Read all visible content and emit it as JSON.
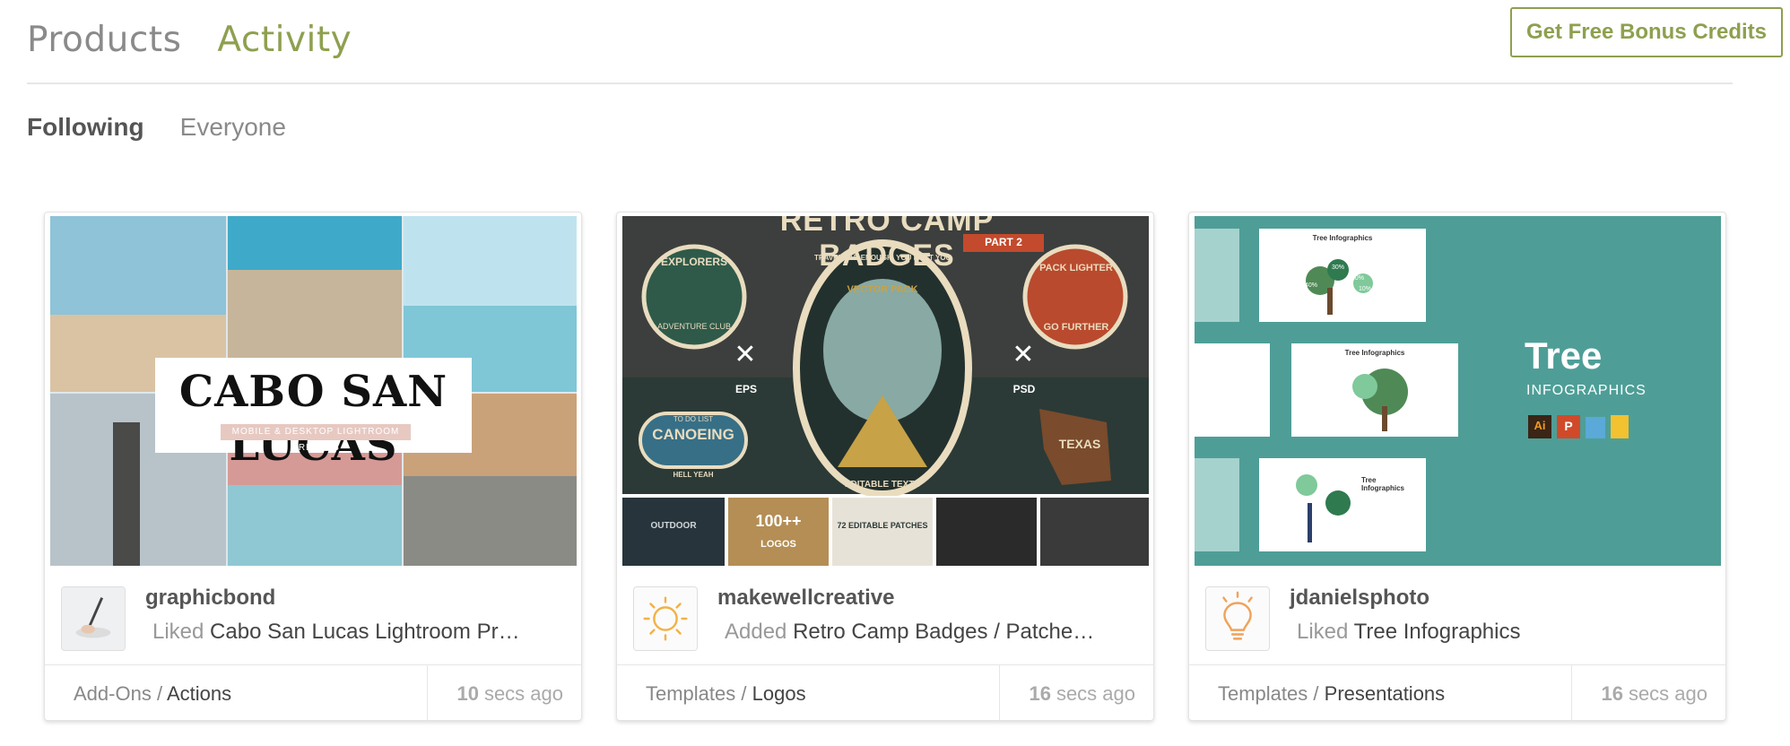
{
  "nav": {
    "tabs": [
      {
        "label": "Products",
        "active": false
      },
      {
        "label": "Activity",
        "active": true
      }
    ],
    "bonus_button": "Get Free Bonus Credits"
  },
  "filters": [
    {
      "label": "Following",
      "active": true
    },
    {
      "label": "Everyone",
      "active": false
    }
  ],
  "colors": {
    "accent": "#8ea04f",
    "teal": "#4e9e97"
  },
  "cards": [
    {
      "thumb_title": "CABO SAN LUCAS",
      "thumb_subtitle": "MOBILE & DESKTOP LIGHTROOM PRESETS",
      "avatar_icon": "user-photo-avatar",
      "user": "graphicbond",
      "verb": "Liked",
      "item": "Cabo San Lucas Lightroom Pr…",
      "category": "Add-Ons",
      "subcategory": "Actions",
      "time_value": "10",
      "time_unit": "secs ago"
    },
    {
      "thumb_title": "RETRO CAMP BADGES",
      "thumb_badges": [
        "EXPLORERS",
        "ADVENTURE CLUB",
        "PART 2",
        "VECTOR PACK",
        "TRAVEL FAR ENOUGH, YOU MEET YOURSELF",
        "PACK LIGHTER",
        "GO FURTHER",
        "EPS",
        "PSD",
        "CANOEING",
        "TO DO LIST",
        "HELL YEAH",
        "TEXAS",
        "EDITABLE TEXTS",
        "OUTDOOR",
        "100++",
        "LOGOS",
        "72 EDITABLE PATCHES"
      ],
      "avatar_icon": "sun-icon",
      "user": "makewellcreative",
      "verb": "Added",
      "item": "Retro Camp Badges / Patche…",
      "category": "Templates",
      "subcategory": "Logos",
      "time_value": "16",
      "time_unit": "secs ago"
    },
    {
      "thumb_title": "Tree",
      "thumb_subtitle": "INFOGRAPHICS",
      "thumb_slide_title": "Tree Infographics",
      "thumb_percents": [
        "30%",
        "40%",
        "20%",
        "10%"
      ],
      "thumb_app_icons": [
        "Ai",
        "P"
      ],
      "avatar_icon": "lightbulb-icon",
      "user": "jdanielsphoto",
      "verb": "Liked",
      "item": "Tree Infographics",
      "category": "Templates",
      "subcategory": "Presentations",
      "time_value": "16",
      "time_unit": "secs ago"
    }
  ]
}
